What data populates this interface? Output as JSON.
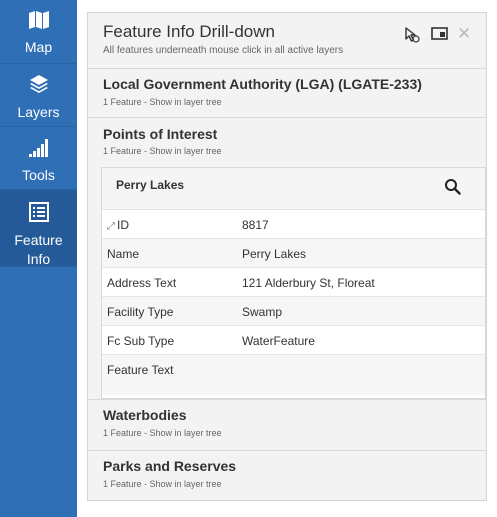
{
  "nav": {
    "items": [
      {
        "label": "Map",
        "icon": "map-icon"
      },
      {
        "label": "Layers",
        "icon": "layers-icon"
      },
      {
        "label": "Tools",
        "icon": "signal-bars-icon"
      },
      {
        "label_line1": "Feature",
        "label_line2": "Info",
        "icon": "list-icon",
        "active": true
      }
    ]
  },
  "panel": {
    "title": "Feature Info Drill-down",
    "subtitle": "All features underneath mouse click in all active layers",
    "close_glyph": "✕"
  },
  "sections": [
    {
      "title": "Local Government Authority (LGA) (LGATE-233)",
      "sub": "1 Feature - Show in layer tree"
    },
    {
      "title": "Points of Interest",
      "sub": "1 Feature - Show in layer tree"
    },
    {
      "title": "Waterbodies",
      "sub": "1 Feature - Show in layer tree"
    },
    {
      "title": "Parks and Reserves",
      "sub": "1 Feature - Show in layer tree"
    }
  ],
  "feature": {
    "title": "Perry Lakes",
    "expand_glyph": "⤢",
    "attributes": [
      {
        "key": "ID",
        "value": "8817"
      },
      {
        "key": "Name",
        "value": "Perry Lakes"
      },
      {
        "key": "Address Text",
        "value": "121 Alderbury St, Floreat"
      },
      {
        "key": "Facility Type",
        "value": "Swamp"
      },
      {
        "key": "Fc Sub Type",
        "value": "WaterFeature"
      },
      {
        "key": "Feature Text",
        "value": ""
      }
    ]
  },
  "colors": {
    "nav_bg": "#2f6fb6",
    "nav_active": "#245a97",
    "panel_bg": "#f3f3f3"
  }
}
